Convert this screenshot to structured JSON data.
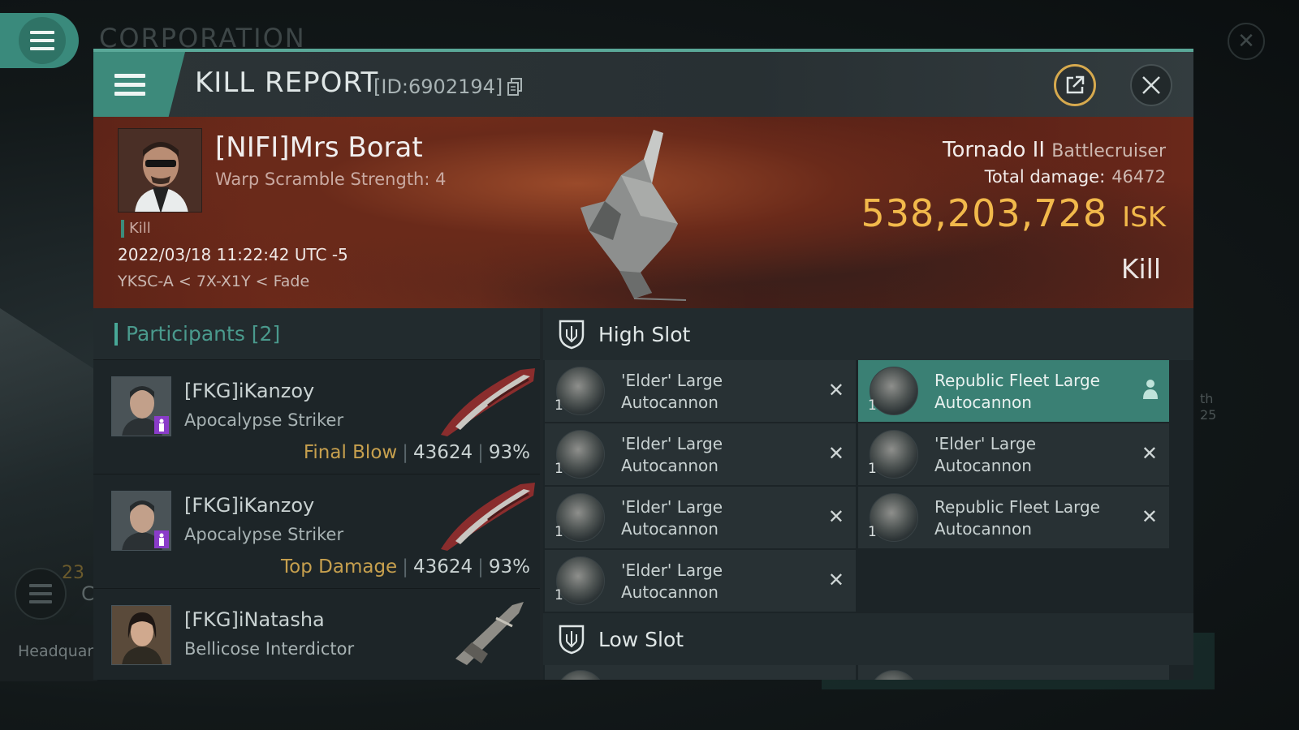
{
  "background": {
    "title": "CORPORATION",
    "hq_label": "Headquar",
    "round_num": "23",
    "c_letter": "C",
    "right_text": [
      "th",
      "25"
    ]
  },
  "window": {
    "title": "KILL REPORT",
    "report_id": "[ID:6902194]"
  },
  "victim": {
    "name": "[NIFI]Mrs Borat",
    "scramble": "Warp Scramble Strength: 4",
    "tag": "Kill",
    "datetime": "2022/03/18 11:22:42 UTC -5",
    "location": "YKSC-A < 7X-X1Y < Fade",
    "ship_name": "Tornado II",
    "ship_class": "Battlecruiser",
    "damage_label": "Total damage:",
    "damage_value": "46472",
    "isk_amount": "538,203,728",
    "isk_currency": "ISK",
    "result": "Kill"
  },
  "participants": {
    "header": "Participants [2]",
    "items": [
      {
        "name": "[FKG]iKanzoy",
        "ship": "Apocalypse Striker",
        "tag": "Final Blow",
        "damage": "43624",
        "percent": "93%"
      },
      {
        "name": "[FKG]iKanzoy",
        "ship": "Apocalypse Striker",
        "tag": "Top Damage",
        "damage": "43624",
        "percent": "93%"
      },
      {
        "name": "[FKG]iNatasha",
        "ship": "Bellicose Interdictor"
      }
    ]
  },
  "high_slot": {
    "label": "High Slot",
    "left": [
      {
        "qty": "1",
        "line1": "'Elder' Large",
        "line2": "Autocannon"
      },
      {
        "qty": "1",
        "line1": "'Elder' Large",
        "line2": "Autocannon"
      },
      {
        "qty": "1",
        "line1": "'Elder' Large",
        "line2": "Autocannon"
      },
      {
        "qty": "1",
        "line1": "'Elder' Large",
        "line2": "Autocannon"
      }
    ],
    "right": [
      {
        "qty": "1",
        "line1": "Republic Fleet Large",
        "line2": "Autocannon"
      },
      {
        "qty": "1",
        "line1": "'Elder' Large",
        "line2": "Autocannon"
      },
      {
        "qty": "1",
        "line1": "Republic Fleet Large",
        "line2": "Autocannon"
      }
    ]
  },
  "low_slot": {
    "label": "Low Slot"
  },
  "colors": {
    "accent": "#3d8a7b",
    "isk": "#f2b94b",
    "tag_gold": "#c7a04e",
    "badge_purple": "#8a3cc9"
  }
}
